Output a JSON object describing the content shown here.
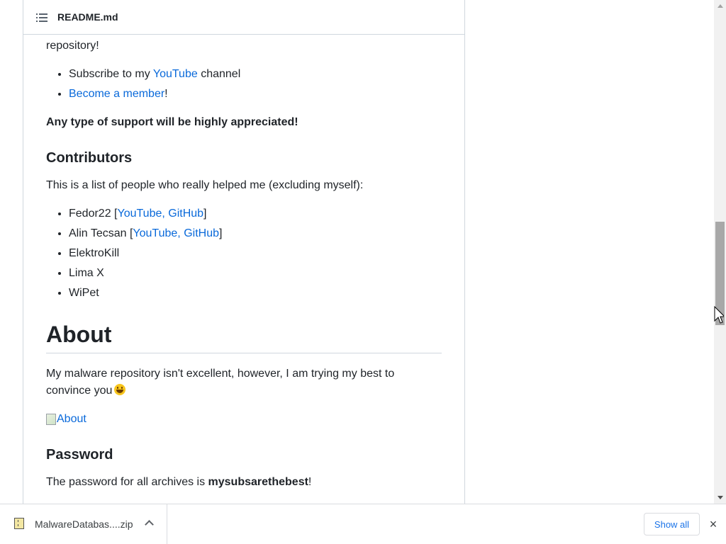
{
  "header": {
    "filename": "README.md",
    "toc_icon": "list-icon"
  },
  "content": {
    "partial_line": "[top portion cut off]",
    "repository_text": "repository!",
    "support_items": [
      {
        "prefix": "Subscribe to my ",
        "link": "YouTube",
        "suffix": " channel"
      },
      {
        "prefix": "",
        "link": "Become a member",
        "suffix": "!"
      }
    ],
    "support_appreciation": "Any type of support will be highly appreciated!",
    "contributors_heading": "Contributors",
    "contributors_intro": "This is a list of people who really helped me (excluding myself):",
    "contributors": [
      {
        "name": "Fedor22",
        "links": "YouTube, GitHub"
      },
      {
        "name": "Alin Tecsan",
        "links": "YouTube, GitHub"
      },
      {
        "name": "ElektroKill",
        "links": ""
      },
      {
        "name": "Lima X",
        "links": ""
      },
      {
        "name": "WiPet",
        "links": ""
      }
    ],
    "about_heading": "About",
    "about_text_line1": "My malware repository isn't excellent, however, I am trying my best to",
    "about_text_line2": "convince you",
    "about_image_alt": "About",
    "password_heading": "Password",
    "password_prefix": "The password for all archives is ",
    "password_value": "mysubsarethebest",
    "password_suffix": "!"
  },
  "download_shelf": {
    "file_name": "MalwareDatabas....zip",
    "show_all_label": "Show all",
    "close_icon": "×"
  },
  "colors": {
    "link": "#0969da",
    "border": "#d0d7de",
    "text": "#1f2328"
  }
}
